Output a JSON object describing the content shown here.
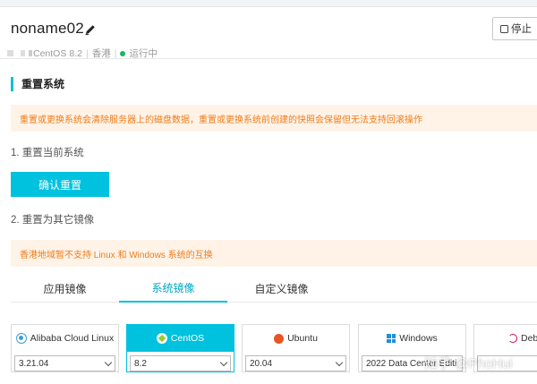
{
  "header": {
    "instance_name": "noname02",
    "os_label": "CentOS",
    "os_version": "8.2",
    "region": "香港",
    "status": "运行中",
    "stop_label": "停止"
  },
  "reset": {
    "section_title": "重置系统",
    "warning_1": "重置或更换系统会清除服务器上的磁盘数据，重置或更换系统前创建的快照会保留但无法支持回滚操作",
    "step_1": "1. 重置当前系统",
    "confirm_label": "确认重置",
    "step_2": "2. 重置为其它镜像",
    "warning_2": "香港地域暂不支持 Linux 和 Windows 系统的互换"
  },
  "tabs": [
    "应用镜像",
    "系统镜像",
    "自定义镜像"
  ],
  "active_tab": "系统镜像",
  "images": [
    {
      "name": "Alibaba Cloud Linux",
      "icon": "alibaba-cloud-linux-icon",
      "version": "3.21.04"
    },
    {
      "name": "CentOS",
      "icon": "centos-icon",
      "version": "8.2",
      "selected": true
    },
    {
      "name": "Ubuntu",
      "icon": "ubuntu-icon",
      "version": "20.04"
    },
    {
      "name": "Windows",
      "icon": "windows-icon",
      "version": "2022 Data Center Editi"
    },
    {
      "name": "Deb",
      "icon": "debian-icon",
      "version": ""
    }
  ],
  "watermark": "知乎 @PhoHui",
  "colors": {
    "accent": "#00c1de",
    "warning_text": "#f07c19",
    "warning_bg": "#fff3e8",
    "status_green": "#18b566"
  }
}
